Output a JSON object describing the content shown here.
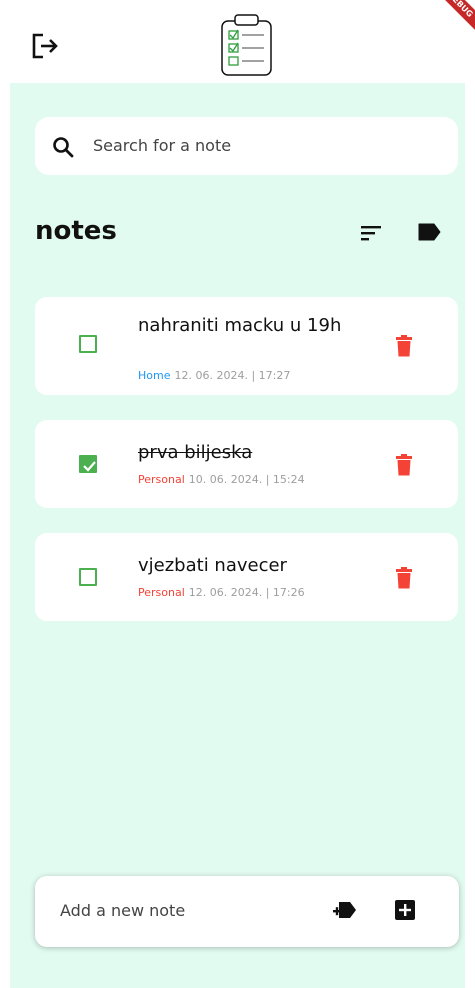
{
  "header": {
    "logout_icon": "logout-icon",
    "logo_icon": "clipboard-checklist-icon",
    "debug_banner": "DEBUG"
  },
  "search": {
    "placeholder": "Search for a note"
  },
  "notes_section": {
    "title": "notes",
    "sort_icon": "sort-icon",
    "label_icon": "label-icon"
  },
  "notes": [
    {
      "text": "nahraniti macku u 19h",
      "done": false,
      "category": "Home",
      "category_color": "#2196f3",
      "date": "12. 06. 2024. | 17:27"
    },
    {
      "text": "prva biljeska",
      "done": true,
      "category": "Personal",
      "category_color": "#f44336",
      "date": "10. 06. 2024. | 15:24"
    },
    {
      "text": "vjezbati navecer",
      "done": false,
      "category": "Personal",
      "category_color": "#f44336",
      "date": "12. 06. 2024. | 17:26"
    }
  ],
  "add_bar": {
    "placeholder": "Add a new note",
    "add_label_icon": "new-label-icon",
    "add_icon": "add-box-icon"
  },
  "colors": {
    "background": "#e2fbf1",
    "check_green": "#4caf50",
    "delete_red": "#f44336"
  }
}
